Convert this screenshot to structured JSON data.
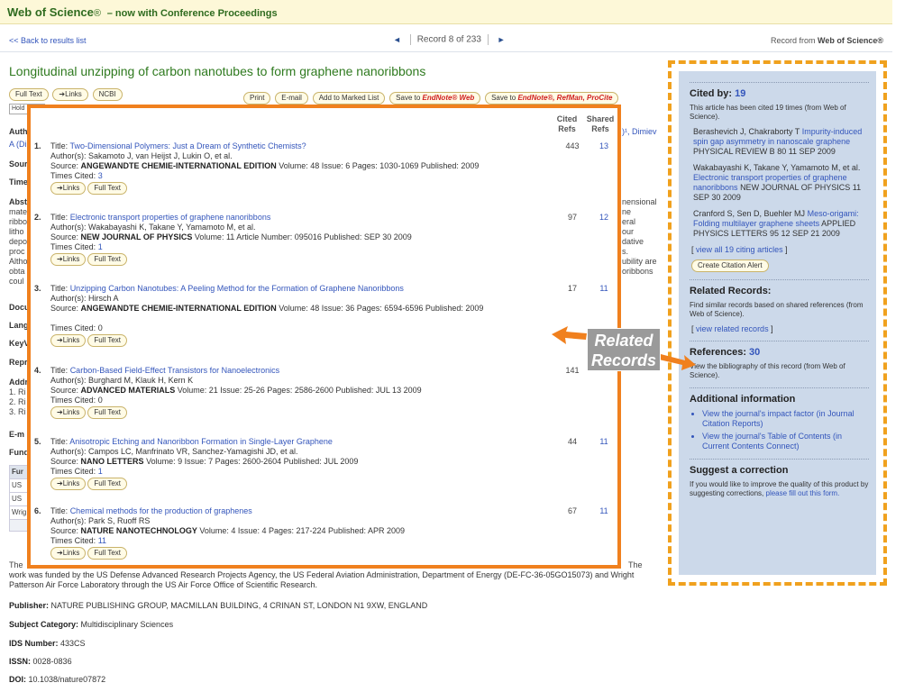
{
  "header": {
    "brand": "Web of Science",
    "reg": "®",
    "tagline": "– now with Conference Proceedings"
  },
  "nav": {
    "back": "<< Back to results list",
    "record_label": "Record",
    "record_num": "8",
    "of_label": "of",
    "record_total": "233",
    "record_from_prefix": "Record from",
    "record_from_source": "Web of Science®"
  },
  "article": {
    "title": "Longitudinal unzipping of carbon nanotubes to form graphene nanoribbons",
    "buttons_left": [
      "Full Text",
      "➔Links",
      "NCBI"
    ],
    "buttons_right": [
      "Print",
      "E-mail",
      "Add to Marked List"
    ],
    "endnote_web_prefix": "Save to",
    "endnote_web_label": "EndNote® Web",
    "endnote_more_prefix": "Save to",
    "endnote_more_label": "EndNote®, RefMan, ProCite",
    "holdings": "Hold"
  },
  "background_fragments": {
    "auth_label": "Auth",
    "auth_link": "A (Di",
    "source_label": "Sour",
    "times_label": "Time",
    "abstract_label": "Abst",
    "abs_lines_left": [
      "mate",
      "ribbo",
      "litho",
      "depo",
      "proc",
      "Altho",
      "obta",
      "coul"
    ],
    "abs_lines_right": [
      "nensional",
      "ne",
      "eral",
      "our",
      "dative",
      "s.",
      "ubility are",
      "oribbons"
    ],
    "author_tail": ")¹, Dimiev",
    "doc_label": "Docu",
    "lang_label": "Lang",
    "key_label": "KeyV",
    "repr_label": "Repr",
    "addr_label": "Addr",
    "addr_lines": [
      "1. Ri",
      "2. Ri",
      "3. Ri"
    ],
    "email_label": "E-m",
    "funding_label": "Fund",
    "funding_cells": [
      "Fur",
      "US",
      "US",
      "Wrig"
    ],
    "body_end": "The",
    "body_tail": "The"
  },
  "funding_text": "work was funded by the US Defense Advanced Research Projects Agency, the US Federal Aviation Administration, Department of Energy (DE-FC-36-05GO15073) and Wright Patterson Air Force Laboratory through the US Air Force Office of Scientific Research.",
  "metadata": {
    "publisher_label": "Publisher:",
    "publisher": "NATURE PUBLISHING GROUP, MACMILLAN BUILDING, 4 CRINAN ST, LONDON N1 9XW, ENGLAND",
    "subject_label": "Subject Category:",
    "subject": "Multidisciplinary Sciences",
    "ids_label": "IDS Number:",
    "ids": "433CS",
    "issn_label": "ISSN:",
    "issn": "0028-0836",
    "doi_label": "DOI:",
    "doi": "10.1038/nature07872"
  },
  "related_popup": {
    "col_cited": "Cited Refs",
    "col_shared": "Shared Refs",
    "title_prefix": "Title:",
    "authors_prefix": "Author(s):",
    "source_prefix": "Source:",
    "times_cited_prefix": "Times Cited:",
    "links_label": "➔Links",
    "fulltext_label": "Full Text",
    "items": [
      {
        "num": "1.",
        "title": "Two-Dimensional Polymers: Just a Dream of Synthetic Chemists?",
        "authors": "Sakamoto J, van Heijst J, Lukin O, et al.",
        "source": "ANGEWANDTE CHEMIE-INTERNATIONAL EDITION",
        "details": "Volume: 48  Issue: 6  Pages: 1030-1069  Published: 2009",
        "times_cited": "3",
        "cited_refs": "443",
        "shared_refs": "13"
      },
      {
        "num": "2.",
        "title": "Electronic transport properties of graphene nanoribbons",
        "authors": "Wakabayashi K, Takane Y, Yamamoto M, et al.",
        "source": "NEW JOURNAL OF PHYSICS",
        "details": "Volume: 11 Article Number: 095016  Published: SEP 30 2009",
        "times_cited": "1",
        "cited_refs": "97",
        "shared_refs": "12"
      },
      {
        "num": "3.",
        "title": "Unzipping Carbon Nanotubes: A Peeling Method for the Formation of Graphene Nanoribbons",
        "authors": "Hirsch A",
        "source": "ANGEWANDTE CHEMIE-INTERNATIONAL EDITION",
        "details": "Volume: 48  Issue: 36  Pages: 6594-6596  Published: 2009",
        "times_cited": "0",
        "cited_refs": "17",
        "shared_refs": "11"
      },
      {
        "num": "4.",
        "title": "Carbon-Based Field-Effect Transistors for Nanoelectronics",
        "authors": "Burghard M, Klauk H, Kern K",
        "source": "ADVANCED MATERIALS",
        "details": "Volume: 21  Issue: 25-26  Pages: 2586-2600  Published: JUL 13 2009",
        "times_cited": "0",
        "cited_refs": "141",
        "shared_refs": ""
      },
      {
        "num": "5.",
        "title": "Anisotropic Etching and Nanoribbon Formation in Single-Layer Graphene",
        "authors": "Campos LC, Manfrinato VR, Sanchez-Yamagishi JD, et al.",
        "source": "NANO LETTERS",
        "details": "Volume: 9  Issue: 7  Pages: 2600-2604  Published: JUL 2009",
        "times_cited": "1",
        "cited_refs": "44",
        "shared_refs": "11"
      },
      {
        "num": "6.",
        "title": "Chemical methods for the production of graphenes",
        "authors": "Park S, Ruoff RS",
        "source": "NATURE NANOTECHNOLOGY",
        "details": "Volume: 4  Issue: 4  Pages: 217-224  Published: APR 2009",
        "times_cited": "11",
        "cited_refs": "67",
        "shared_refs": "11"
      }
    ]
  },
  "callout": {
    "line1": "Related",
    "line2": "Records",
    "color": "#f0801e"
  },
  "sidebar": {
    "cited_by_label": "Cited by:",
    "cited_by_count": "19",
    "cited_by_note": "This article has been cited 19 times (from Web of Science).",
    "citing_articles": [
      {
        "authors": "Berashevich J, Chakraborty T",
        "title": "Impurity-induced spin gap asymmetry in nanoscale graphene",
        "journal": "PHYSICAL REVIEW B  80  11  SEP 2009"
      },
      {
        "authors": "Wakabayashi K, Takane Y, Yamamoto M, et al.",
        "title": "Electronic transport properties of graphene nanoribbons",
        "journal": "NEW JOURNAL OF PHYSICS  11  SEP 30 2009"
      },
      {
        "authors": "Cranford S, Sen D, Buehler MJ",
        "title": "Meso-origami: Folding multilayer graphene sheets",
        "journal": "APPLIED PHYSICS LETTERS  95  12  SEP 21 2009"
      }
    ],
    "view_all_citing": "view all 19 citing articles",
    "create_alert": "Create Citation Alert",
    "related_head": "Related Records:",
    "related_note": "Find similar records based on shared references (from Web of Science).",
    "view_related": "view related records",
    "references_label": "References:",
    "references_count": "30",
    "references_note": "View the bibliography of this record (from Web of Science).",
    "additional_head": "Additional information",
    "additional_items": [
      "View the journal's impact factor (in Journal Citation Reports)",
      "View the journal's Table of Contents (in Current Contents Connect)"
    ],
    "suggest_head": "Suggest a correction",
    "suggest_text": "If you would like to improve the quality of this product by suggesting corrections,",
    "suggest_link": "please fill out this form."
  }
}
